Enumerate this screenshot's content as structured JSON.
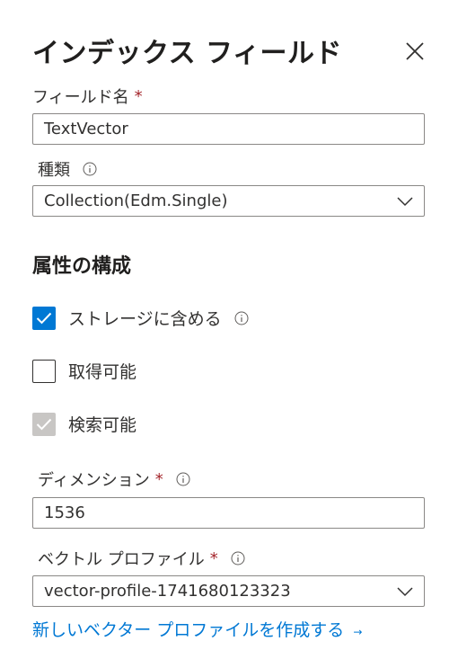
{
  "panel": {
    "title": "インデックス フィールド",
    "close_icon": "close-icon"
  },
  "field_name": {
    "label": "フィールド名",
    "required_mark": "*",
    "value": "TextVector"
  },
  "type": {
    "label": "種類",
    "info_icon": "info-icon",
    "selected": "Collection(Edm.Single)"
  },
  "attributes": {
    "heading": "属性の構成",
    "items": [
      {
        "label": "ストレージに含める",
        "state": "checked",
        "has_info": true
      },
      {
        "label": "取得可能",
        "state": "unchecked",
        "has_info": false
      },
      {
        "label": "検索可能",
        "state": "checked-disabled",
        "has_info": false
      }
    ]
  },
  "dimensions": {
    "label": "ディメンション",
    "required_mark": "*",
    "info_icon": "info-icon",
    "value": "1536"
  },
  "vector_profile": {
    "label": "ベクトル プロファイル",
    "required_mark": "*",
    "info_icon": "info-icon",
    "selected": "vector-profile-1741680123323"
  },
  "create_link": {
    "text": "新しいベクター プロファイルを作成する",
    "arrow": "→"
  },
  "colors": {
    "accent": "#0078d4",
    "required": "#a4262c",
    "disabled": "#c8c6c4",
    "text": "#323130"
  }
}
